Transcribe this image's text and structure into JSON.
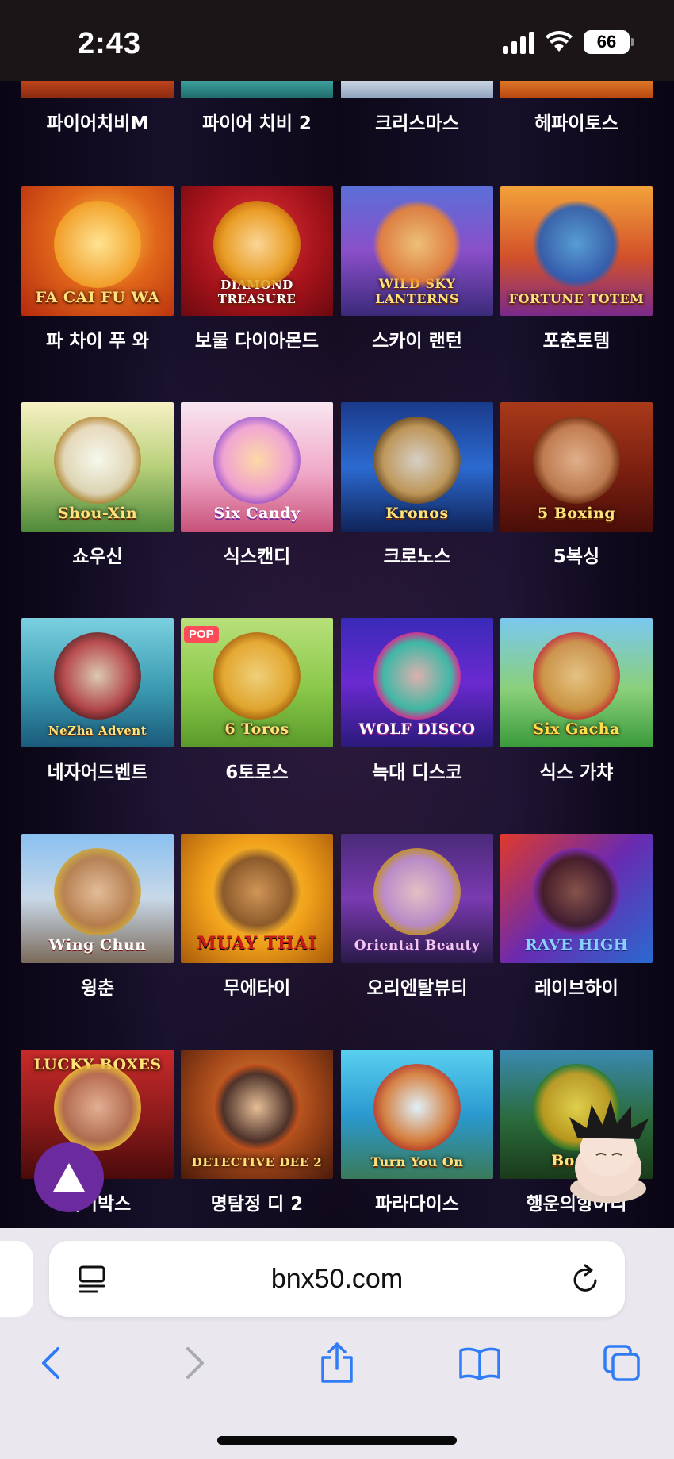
{
  "status_bar": {
    "time": "2:43",
    "battery": "66"
  },
  "top_row_labels": [
    "파이어치비M",
    "파이어 치비 2",
    "크리스마스",
    "헤파이토스"
  ],
  "games": [
    {
      "label": "파 차이 푸 와",
      "thumb_title": "FA CAI FU WA"
    },
    {
      "label": "보물 다이아몬드",
      "thumb_title": "DIAMOND TREASURE"
    },
    {
      "label": "스카이 랜턴",
      "thumb_title": "WILD SKY LANTERNS"
    },
    {
      "label": "포춘토템",
      "thumb_title": "FORTUNE TOTEM"
    },
    {
      "label": "쇼우신",
      "thumb_title": "Shou-Xin"
    },
    {
      "label": "식스캔디",
      "thumb_title": "Six Candy"
    },
    {
      "label": "크로노스",
      "thumb_title": "Kronos"
    },
    {
      "label": "5복싱",
      "thumb_title": "5 Boxing"
    },
    {
      "label": "네자어드벤트",
      "thumb_title": "NeZha Advent"
    },
    {
      "label": "6토로스",
      "thumb_title": "6 Toros",
      "badge": "POP"
    },
    {
      "label": "늑대 디스코",
      "thumb_title": "WOLF DISCO"
    },
    {
      "label": "식스 가챠",
      "thumb_title": "Six Gacha"
    },
    {
      "label": "윙춘",
      "thumb_title": "Wing Chun"
    },
    {
      "label": "무에타이",
      "thumb_title": "MUAY THAI"
    },
    {
      "label": "오리엔탈뷰티",
      "thumb_title": "Oriental Beauty"
    },
    {
      "label": "레이브하이",
      "thumb_title": "RAVE HIGH"
    },
    {
      "label": "럭키박스",
      "thumb_title": "LUCKY BOXES"
    },
    {
      "label": "명탐정 디 2",
      "thumb_title": "DETECTIVE DEE 2"
    },
    {
      "label": "파라다이스",
      "thumb_title": "Turn You On"
    },
    {
      "label": "행운의항아리",
      "thumb_title": "Booty"
    }
  ],
  "browser": {
    "url": "bnx50.com"
  },
  "icons": {
    "scroll_top": "triangle-up-icon",
    "page_menu": "page-menu-icon",
    "reload": "reload-icon",
    "back": "chevron-left-icon",
    "forward": "chevron-right-icon",
    "share": "share-icon",
    "bookmarks": "book-icon",
    "tabs": "tabs-icon"
  },
  "colors": {
    "accent": "#2f7cf6",
    "fab": "#6b2a9e",
    "content_bg": "#0b0612"
  }
}
